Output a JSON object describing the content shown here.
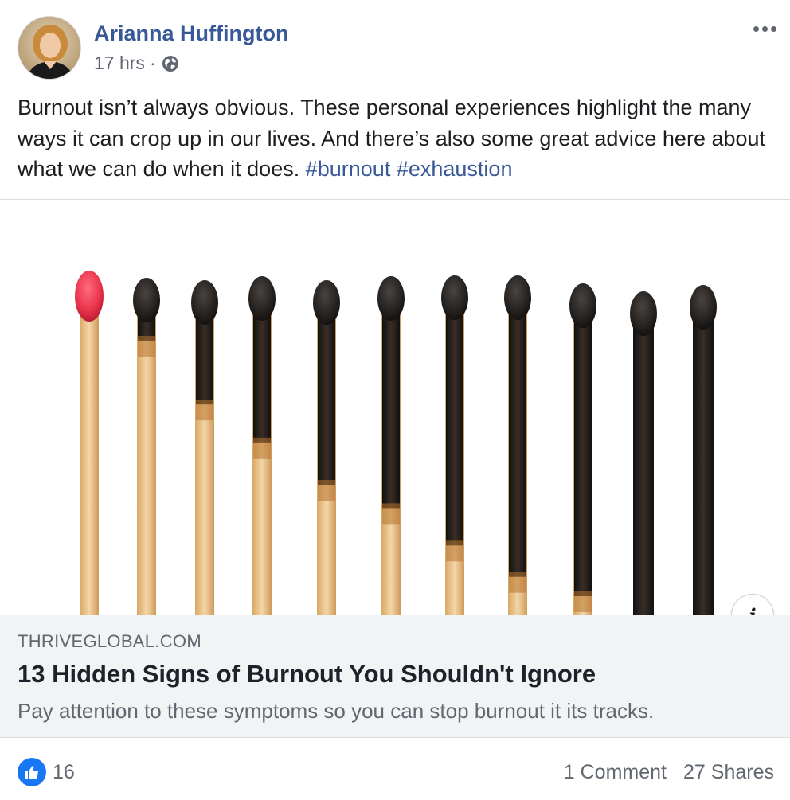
{
  "post": {
    "author": "Arianna Huffington",
    "time": "17 hrs",
    "separator": "·",
    "privacy_icon": "globe-icon",
    "more_icon": "more-options-icon",
    "text": "Burnout isn’t always obvious. These personal experiences highlight the many ways it can crop up in our lives. And there’s also some great advice here about what we can do when it does.",
    "hashtags": [
      "#burnout",
      "#exhaustion"
    ]
  },
  "link": {
    "domain": "THRIVEGLOBAL.COM",
    "title": "13 Hidden Signs of Burnout You Shouldn't Ignore",
    "description": "Pay attention to these symptoms so you can stop burnout it its tracks.",
    "info_icon": "info-icon"
  },
  "footer": {
    "reaction_icon": "like-icon",
    "like_count": "16",
    "comments": "1 Comment",
    "shares": "27 Shares"
  },
  "colors": {
    "link_blue": "#385898",
    "like_blue": "#1877f2",
    "secondary_text": "#606770",
    "match_head_red": "#e8324a"
  }
}
